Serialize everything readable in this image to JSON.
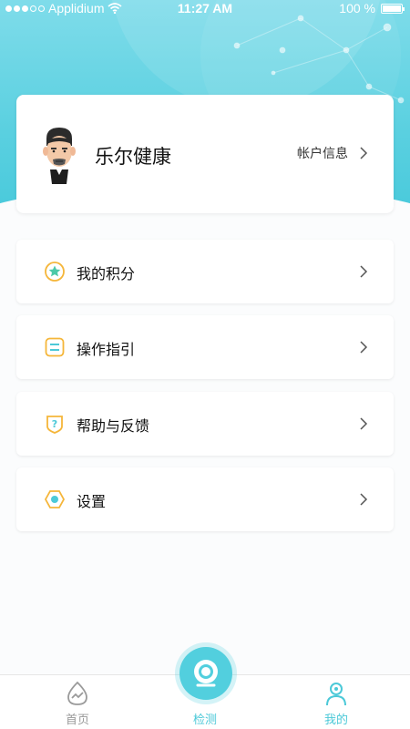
{
  "status_bar": {
    "carrier": "Applidium",
    "time": "11:27 AM",
    "battery": "100 %"
  },
  "profile": {
    "name": "乐尔健康",
    "account_link": "帐户信息"
  },
  "menu": [
    {
      "label": "我的积分",
      "icon": "points-star-icon"
    },
    {
      "label": "操作指引",
      "icon": "guide-list-icon"
    },
    {
      "label": "帮助与反馈",
      "icon": "help-question-icon"
    },
    {
      "label": "设置",
      "icon": "settings-hexagon-icon"
    }
  ],
  "tabbar": {
    "home": "首页",
    "detect": "检测",
    "mine": "我的"
  },
  "colors": {
    "accent": "#4cc9d8",
    "icon_orange": "#f5b63a"
  }
}
